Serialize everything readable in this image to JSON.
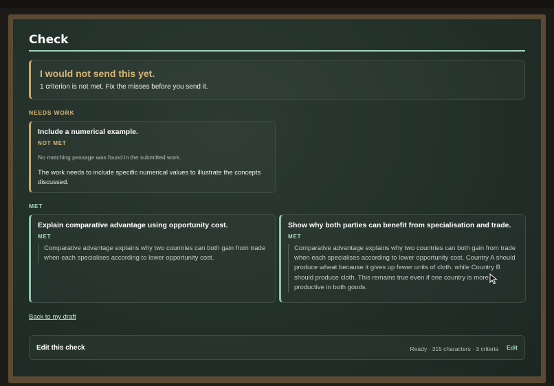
{
  "page": {
    "title": "Check"
  },
  "verdict": {
    "heading": "I would not send this yet.",
    "summary": "1 criterion is not met. Fix the misses before you send it."
  },
  "sections": {
    "needs_work_label": "NEEDS WORK",
    "met_label": "MET"
  },
  "needs_work_cards": [
    {
      "title": "Include a numerical example.",
      "status": "NOT MET",
      "note": "No matching passage was found in the submitted work.",
      "feedback": "The work needs to include specific numerical values to illustrate the concepts discussed."
    }
  ],
  "met_cards": [
    {
      "title": "Explain comparative advantage using opportunity cost.",
      "status": "MET",
      "quote": "Comparative advantage explains why two countries can both gain from trade when each specialises according to lower opportunity cost."
    },
    {
      "title": "Show why both parties can benefit from specialisation and trade.",
      "status": "MET",
      "quote": "Comparative advantage explains why two countries can both gain from trade when each specialises according to lower opportunity cost. Country A should produce wheat because it gives up fewer units of cloth, while Country B should produce cloth. This remains true even if one country is more productive in both goods."
    }
  ],
  "back_link": "Back to my draft",
  "edit_bar": {
    "title": "Edit this check",
    "meta": "Ready · 315 characters · 3 criteria",
    "edit_label": "Edit"
  },
  "colors": {
    "accent_warn": "#caa86c",
    "accent_ok": "#8cc7ad",
    "background": "#223029"
  }
}
